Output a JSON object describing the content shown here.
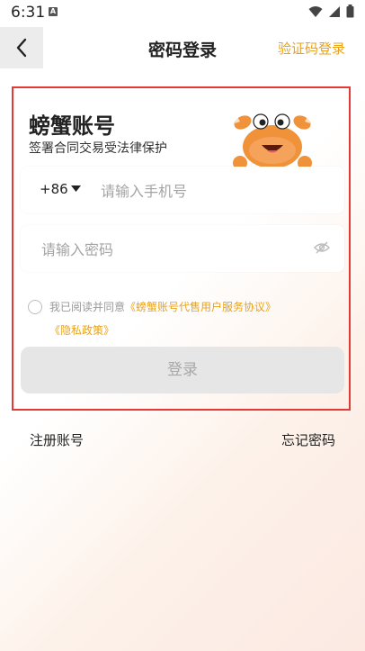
{
  "status_bar": {
    "time": "6:31",
    "badge": "A"
  },
  "nav": {
    "title": "密码登录",
    "right_action": "验证码登录"
  },
  "brand": {
    "title": "螃蟹账号",
    "subtitle": "签署合同交易受法律保护"
  },
  "phone": {
    "country_code": "+86",
    "placeholder": "请输入手机号",
    "value": ""
  },
  "password": {
    "placeholder": "请输入密码",
    "value": ""
  },
  "agreement": {
    "checked": false,
    "prefix": "我已阅读并同意",
    "service_link": "《螃蟹账号代售用户服务协议》",
    "privacy_link": "《隐私政策》"
  },
  "login_button": {
    "label": "登录"
  },
  "footer": {
    "register": "注册账号",
    "forgot": "忘记密码"
  },
  "colors": {
    "accent": "#e8a31a",
    "highlight_border": "#e53935",
    "crab": "#f0923a"
  },
  "icons": [
    "back-arrow-icon",
    "chevron-down-icon",
    "eye-slash-icon",
    "wifi-icon",
    "signal-icon",
    "battery-icon",
    "crab-mascot"
  ]
}
